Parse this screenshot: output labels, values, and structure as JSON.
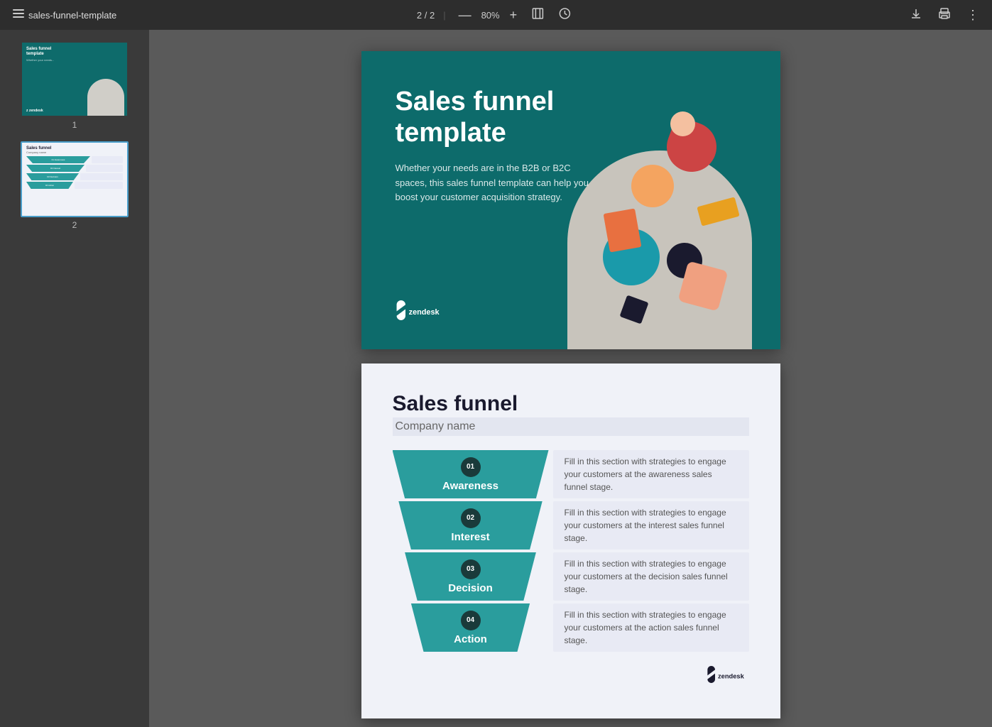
{
  "topbar": {
    "menu_label": "☰",
    "title": "sales-funnel-template",
    "page_current": "2",
    "page_total": "2",
    "zoom": "80%",
    "zoom_out": "—",
    "zoom_in": "+",
    "fit_page_icon": "fit",
    "history_icon": "history",
    "download_icon": "⬇",
    "print_icon": "🖨",
    "more_icon": "⋮"
  },
  "sidebar": {
    "thumb1_label": "1",
    "thumb2_label": "2"
  },
  "cover": {
    "title": "Sales funnel template",
    "description": "Whether your needs are in the B2B or B2C spaces, this sales funnel template can help you boost your customer acquisition strategy.",
    "logo_text": "zendesk"
  },
  "funnel_slide": {
    "title": "Sales funnel",
    "company": "Company name",
    "stages": [
      {
        "number": "01",
        "label": "Awareness",
        "description": "Fill in this section with strategies to engage your customers at the awareness sales funnel stage."
      },
      {
        "number": "02",
        "label": "Interest",
        "description": "Fill in this section with strategies to engage your customers at the interest sales funnel stage."
      },
      {
        "number": "03",
        "label": "Decision",
        "description": "Fill in this section with strategies to engage your customers at the decision sales funnel stage."
      },
      {
        "number": "04",
        "label": "Action",
        "description": "Fill in this section with strategies to engage your customers at the action sales funnel stage."
      }
    ]
  },
  "colors": {
    "teal_dark": "#0d6b6b",
    "teal_mid": "#2a9d9d",
    "navy_badge": "#1a3a3a",
    "bg_slide2": "#f0f2f8",
    "desc_box": "#e8eaf4"
  }
}
